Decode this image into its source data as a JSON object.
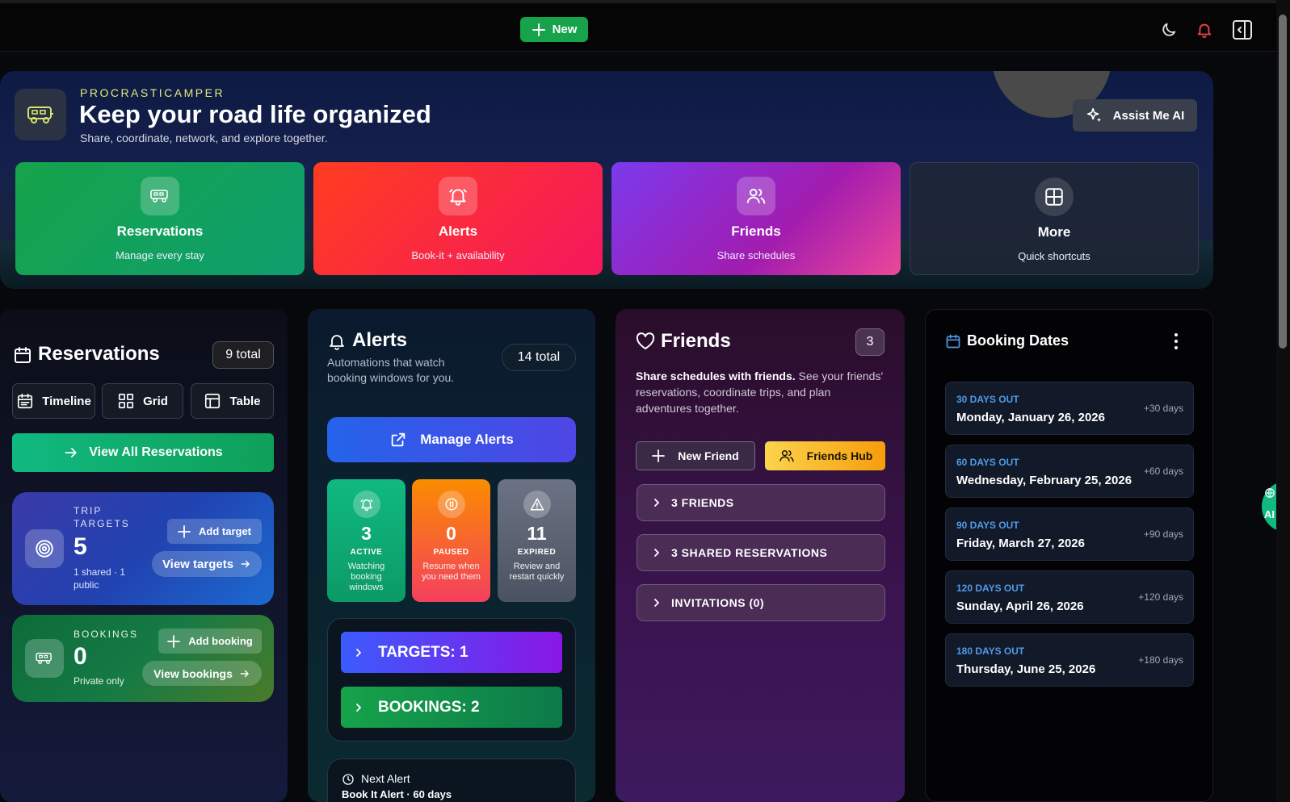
{
  "topbar": {
    "new_label": "New"
  },
  "hero": {
    "brand": "PROCRASTICAMPER",
    "title": "Keep your road life organized",
    "subtitle": "Share, coordinate, network, and explore together.",
    "assist_label": "Assist Me AI",
    "tiles": [
      {
        "label": "Reservations",
        "sub": "Manage every stay",
        "icon": "rv-icon"
      },
      {
        "label": "Alerts",
        "sub": "Book-it + availability",
        "icon": "bell-icon"
      },
      {
        "label": "Friends",
        "sub": "Share schedules",
        "icon": "users-icon"
      },
      {
        "label": "More",
        "sub": "Quick shortcuts",
        "icon": "grid-icon"
      }
    ]
  },
  "reservations": {
    "title": "Reservations",
    "total": "9 total",
    "views": [
      "Timeline",
      "Grid",
      "Table"
    ],
    "view_all": "View All Reservations",
    "trip_targets": {
      "label": "TRIP TARGETS",
      "count": "5",
      "meta": "1 shared · 1 public",
      "add": "Add target",
      "view": "View targets"
    },
    "bookings": {
      "label": "BOOKINGS",
      "count": "0",
      "meta": "Private only",
      "add": "Add booking",
      "view": "View bookings"
    }
  },
  "alerts": {
    "title": "Alerts",
    "subtitle": "Automations that watch booking windows for you.",
    "total": "14 total",
    "manage": "Manage Alerts",
    "stats": [
      {
        "num": "3",
        "label": "ACTIVE",
        "desc": "Watching booking windows"
      },
      {
        "num": "0",
        "label": "PAUSED",
        "desc": "Resume when you need them"
      },
      {
        "num": "11",
        "label": "EXPIRED",
        "desc": "Review and restart quickly"
      }
    ],
    "targets": "TARGETS: 1",
    "bookings": "BOOKINGS: 2",
    "next_alert_title": "Next Alert",
    "next_alert_detail": "Book It Alert · 60 days"
  },
  "friends": {
    "title": "Friends",
    "count": "3",
    "desc_bold": "Share schedules with friends.",
    "desc": " See your friends' reservations, coordinate trips, and plan adventures together.",
    "new_friend": "New Friend",
    "hub": "Friends Hub",
    "sections": [
      "3 FRIENDS",
      "3 SHARED RESERVATIONS",
      "INVITATIONS (0)"
    ]
  },
  "booking_dates": {
    "title": "Booking Dates",
    "items": [
      {
        "label": "30 DAYS OUT",
        "date": "Monday, January 26, 2026",
        "offset": "+30 days"
      },
      {
        "label": "60 DAYS OUT",
        "date": "Wednesday, February 25, 2026",
        "offset": "+60 days"
      },
      {
        "label": "90 DAYS OUT",
        "date": "Friday, March 27, 2026",
        "offset": "+90 days"
      },
      {
        "label": "120 DAYS OUT",
        "date": "Sunday, April 26, 2026",
        "offset": "+120 days"
      },
      {
        "label": "180 DAYS OUT",
        "date": "Thursday, June 25, 2026",
        "offset": "+180 days"
      }
    ]
  },
  "ai_fab": "AI",
  "colors": {
    "green": "#16a34a",
    "alerts_red": "#f43f5e",
    "friends_purple": "#9333ea",
    "blue_accent": "#4f9be8",
    "hub_yellow": "#fbbf24"
  }
}
